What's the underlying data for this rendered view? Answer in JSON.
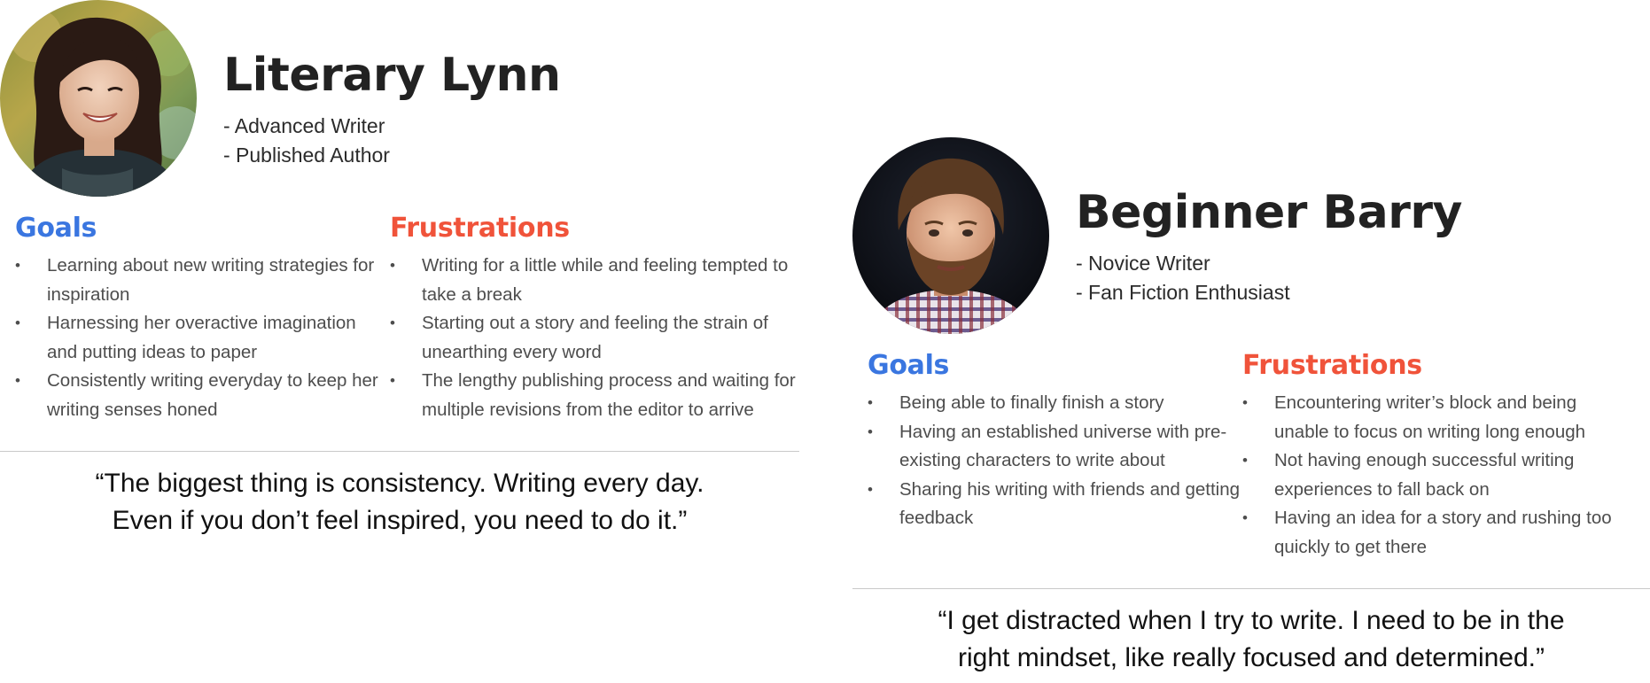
{
  "personas": [
    {
      "name": "Literary Lynn",
      "roles": [
        "- Advanced Writer",
        "- Published Author"
      ],
      "goals_heading": "Goals",
      "goals": [
        "Learning about new writing strategies for inspiration",
        "Harnessing her overactive imagination and putting ideas to paper",
        "Consistently writing everyday to keep her writing senses honed"
      ],
      "frustrations_heading": "Frustrations",
      "frustrations": [
        "Writing for a little while and feeling tempted to take a break",
        "Starting out a story and feeling the strain of unearthing every word",
        "The lengthy publishing process and waiting for multiple revisions from the editor to arrive"
      ],
      "quote_line1": "“The biggest thing is consistency. Writing every day.",
      "quote_line2": "Even if you don’t feel inspired, you need to do it.”"
    },
    {
      "name": "Beginner Barry",
      "roles": [
        "- Novice Writer",
        "- Fan Fiction Enthusiast"
      ],
      "goals_heading": "Goals",
      "goals": [
        "Being able to finally finish a story",
        "Having an established universe with pre-existing characters to write about",
        "Sharing his writing with friends and getting feedback"
      ],
      "frustrations_heading": "Frustrations",
      "frustrations": [
        "Encountering writer’s block and being unable to focus on writing long enough",
        "Not having enough successful writing experiences to fall back on",
        "Having an idea for a story and rushing too quickly to get there"
      ],
      "quote_line1": "“I get distracted when I try to write. I need to be in the",
      "quote_line2": "right mindset, like really focused and determined.”"
    }
  ],
  "colors": {
    "goals": "#3a76e0",
    "frustrations": "#f0533a",
    "heading": "#222222",
    "body_text": "#4d4d4d",
    "divider": "#c9c9c9"
  }
}
